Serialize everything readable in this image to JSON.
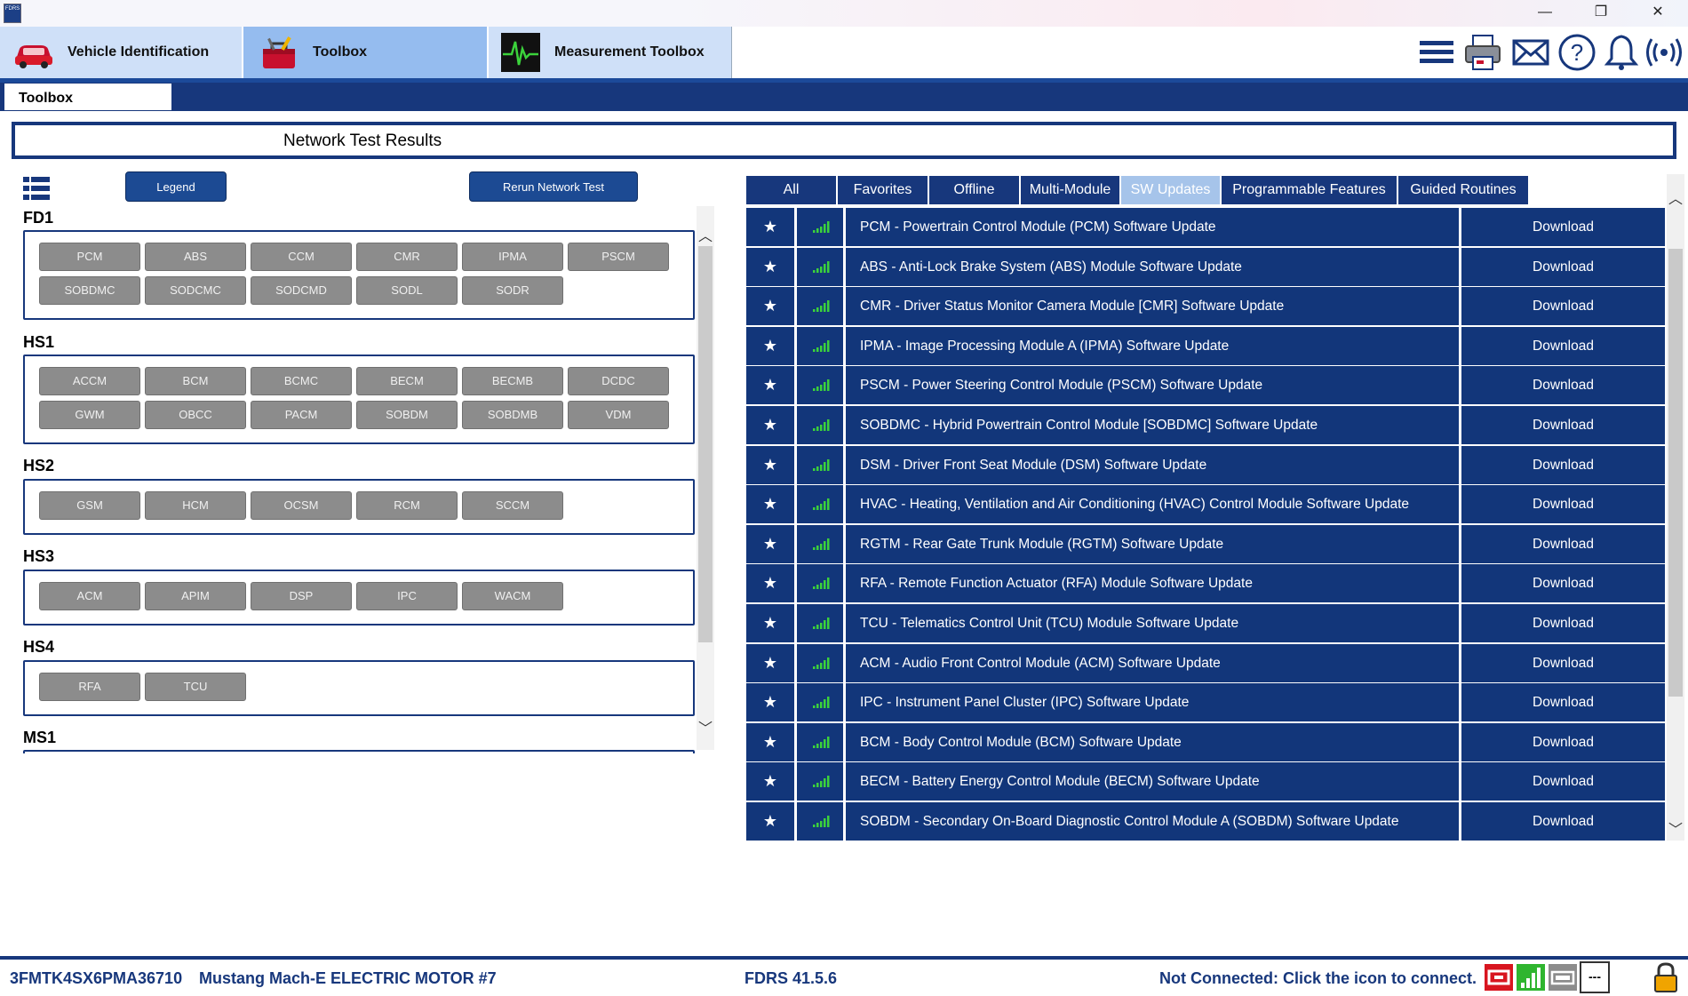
{
  "window": {
    "app_icon_text": "FDRS",
    "controls": {
      "minimize": "—",
      "restore": "❐",
      "close": "✕"
    }
  },
  "top_tabs": [
    {
      "label": "Vehicle Identification",
      "icon": "car-icon"
    },
    {
      "label": "Toolbox",
      "icon": "toolbox-icon"
    },
    {
      "label": "Measurement Toolbox",
      "icon": "waveform-icon"
    }
  ],
  "toolbar_icons": [
    "menu-icon",
    "printer-icon",
    "mail-icon",
    "help-icon",
    "bell-icon",
    "connection-icon"
  ],
  "subtab": {
    "label": "Toolbox"
  },
  "page_title": "Network Test Results",
  "buttons": {
    "legend": "Legend",
    "rerun": "Rerun Network Test"
  },
  "networks": [
    {
      "name": "FD1",
      "modules": [
        "PCM",
        "ABS",
        "CCM",
        "CMR",
        "IPMA",
        "PSCM",
        "SOBDMC",
        "SODCMC",
        "SODCMD",
        "SODL",
        "SODR"
      ]
    },
    {
      "name": "HS1",
      "modules": [
        "ACCM",
        "BCM",
        "BCMC",
        "BECM",
        "BECMB",
        "DCDC",
        "GWM",
        "OBCC",
        "PACM",
        "SOBDM",
        "SOBDMB",
        "VDM"
      ]
    },
    {
      "name": "HS2",
      "modules": [
        "GSM",
        "HCM",
        "OCSM",
        "RCM",
        "SCCM"
      ]
    },
    {
      "name": "HS3",
      "modules": [
        "ACM",
        "APIM",
        "DSP",
        "IPC",
        "WACM"
      ]
    },
    {
      "name": "HS4",
      "modules": [
        "RFA",
        "TCU"
      ]
    },
    {
      "name": "MS1",
      "modules": []
    }
  ],
  "filter_tabs": [
    {
      "label": "All",
      "selected": false
    },
    {
      "label": "Favorites",
      "selected": false
    },
    {
      "label": "Offline",
      "selected": false
    },
    {
      "label": "Multi-Module",
      "selected": false
    },
    {
      "label": "SW Updates",
      "selected": true
    },
    {
      "label": "Programmable Features",
      "selected": false
    },
    {
      "label": "Guided Routines",
      "selected": false
    }
  ],
  "updates": [
    {
      "title": "PCM - Powertrain Control Module (PCM) Software Update",
      "action": "Download"
    },
    {
      "title": "ABS - Anti-Lock Brake System (ABS) Module Software Update",
      "action": "Download"
    },
    {
      "title": "CMR - Driver Status Monitor Camera Module [CMR] Software Update",
      "action": "Download"
    },
    {
      "title": "IPMA - Image Processing Module A (IPMA) Software Update",
      "action": "Download"
    },
    {
      "title": "PSCM - Power Steering Control Module (PSCM) Software Update",
      "action": "Download"
    },
    {
      "title": "SOBDMC - Hybrid Powertrain Control Module [SOBDMC] Software Update",
      "action": "Download"
    },
    {
      "title": "DSM - Driver Front Seat Module (DSM) Software Update",
      "action": "Download"
    },
    {
      "title": "HVAC - Heating, Ventilation and Air Conditioning (HVAC) Control Module Software Update",
      "action": "Download"
    },
    {
      "title": "RGTM - Rear Gate Trunk Module (RGTM) Software Update",
      "action": "Download"
    },
    {
      "title": "RFA - Remote Function Actuator (RFA) Module Software Update",
      "action": "Download"
    },
    {
      "title": "TCU - Telematics Control Unit (TCU) Module Software Update",
      "action": "Download"
    },
    {
      "title": "ACM - Audio Front Control Module (ACM) Software Update",
      "action": "Download"
    },
    {
      "title": "IPC - Instrument Panel Cluster (IPC) Software Update",
      "action": "Download"
    },
    {
      "title": "BCM - Body Control Module (BCM) Software Update",
      "action": "Download"
    },
    {
      "title": "BECM - Battery Energy Control Module (BECM) Software Update",
      "action": "Download"
    },
    {
      "title": "SOBDM - Secondary On-Board Diagnostic Control Module A (SOBDM) Software Update",
      "action": "Download"
    }
  ],
  "status": {
    "vin": "3FMTK4SX6PMA36710",
    "vehicle": "Mustang Mach-E ELECTRIC MOTOR #7",
    "version": "FDRS 41.5.6",
    "connection": "Not Connected: Click the icon to connect.",
    "signal_placeholder": "---"
  },
  "colors": {
    "navy": "#17377c",
    "row_bg": "#12367a",
    "tab_light": "#cfe0f8",
    "tab_active": "#95bcef",
    "module_gray": "#8c8c8c",
    "signal_green": "#3bd23b"
  }
}
